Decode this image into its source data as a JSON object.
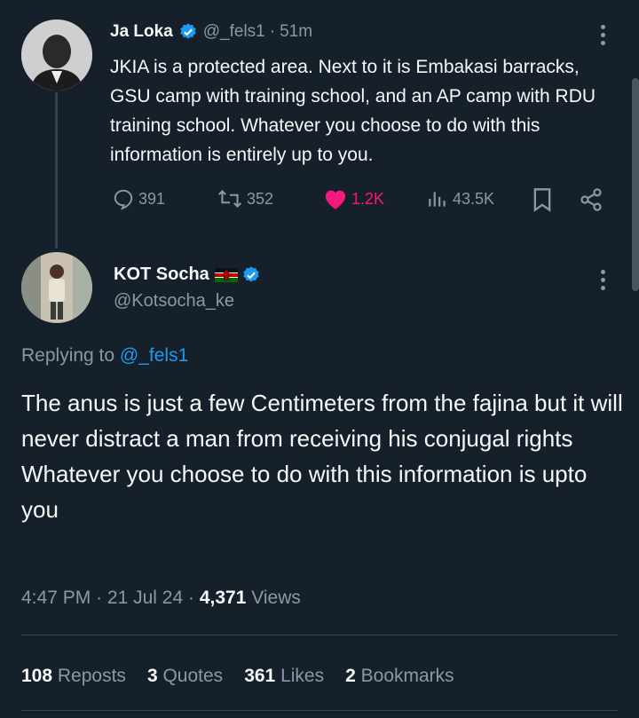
{
  "parent_tweet": {
    "display_name": "Ja Loka",
    "handle": "@_fels1",
    "separator": "·",
    "time_ago": "51m",
    "text": "JKIA is a protected area. Next to it is Embakasi barracks, GSU camp with training school, and an AP camp with RDU training school. Whatever you choose to do with this information is entirely up to you.",
    "replies": "391",
    "reposts": "352",
    "likes": "1.2K",
    "views": "43.5K",
    "verified": true
  },
  "reply_tweet": {
    "display_name": "KOT Socha",
    "handle": "@Kotsocha_ke",
    "flag": "kenya-flag",
    "verified": true,
    "replying_to_label": "Replying to",
    "replying_to_handle": "@_fels1",
    "text_line1": "The anus is just a few Centimeters from the fajina but it will never distract a man from receiving his conjugal rights",
    "text_line2": "Whatever you choose to do with this information is upto you",
    "time": "4:47 PM",
    "dot1": "·",
    "date": "21 Jul 24",
    "dot2": "·",
    "views_count": "4,371",
    "views_label": "Views"
  },
  "stats": {
    "reposts_count": "108",
    "reposts_label": "Reposts",
    "quotes_count": "3",
    "quotes_label": "Quotes",
    "likes_count": "361",
    "likes_label": "Likes",
    "bookmarks_count": "2",
    "bookmarks_label": "Bookmarks"
  },
  "colors": {
    "background": "#15202b",
    "text": "#f7f9f9",
    "muted": "#8b98a5",
    "accent": "#1d9bf0",
    "like": "#f91880"
  }
}
